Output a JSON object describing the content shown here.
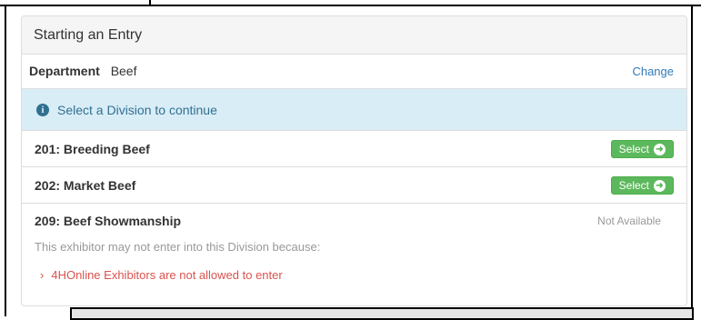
{
  "panel": {
    "title": "Starting an Entry"
  },
  "department": {
    "label": "Department",
    "value": "Beef",
    "change_label": "Change"
  },
  "alert": {
    "message": "Select a Division to continue"
  },
  "divisions": [
    {
      "name": "201: Breeding Beef",
      "action": "Select"
    },
    {
      "name": "202: Market Beef",
      "action": "Select"
    },
    {
      "name": "209: Beef Showmanship",
      "status": "Not Available",
      "reason": "This exhibitor may not enter into this Division because:",
      "reason_items": [
        "4HOnline Exhibitors are not allowed to enter"
      ]
    }
  ],
  "colors": {
    "accent": "#337ab7",
    "success": "#5cb85c",
    "info_bg": "#d9edf7",
    "danger": "#d9534f"
  }
}
